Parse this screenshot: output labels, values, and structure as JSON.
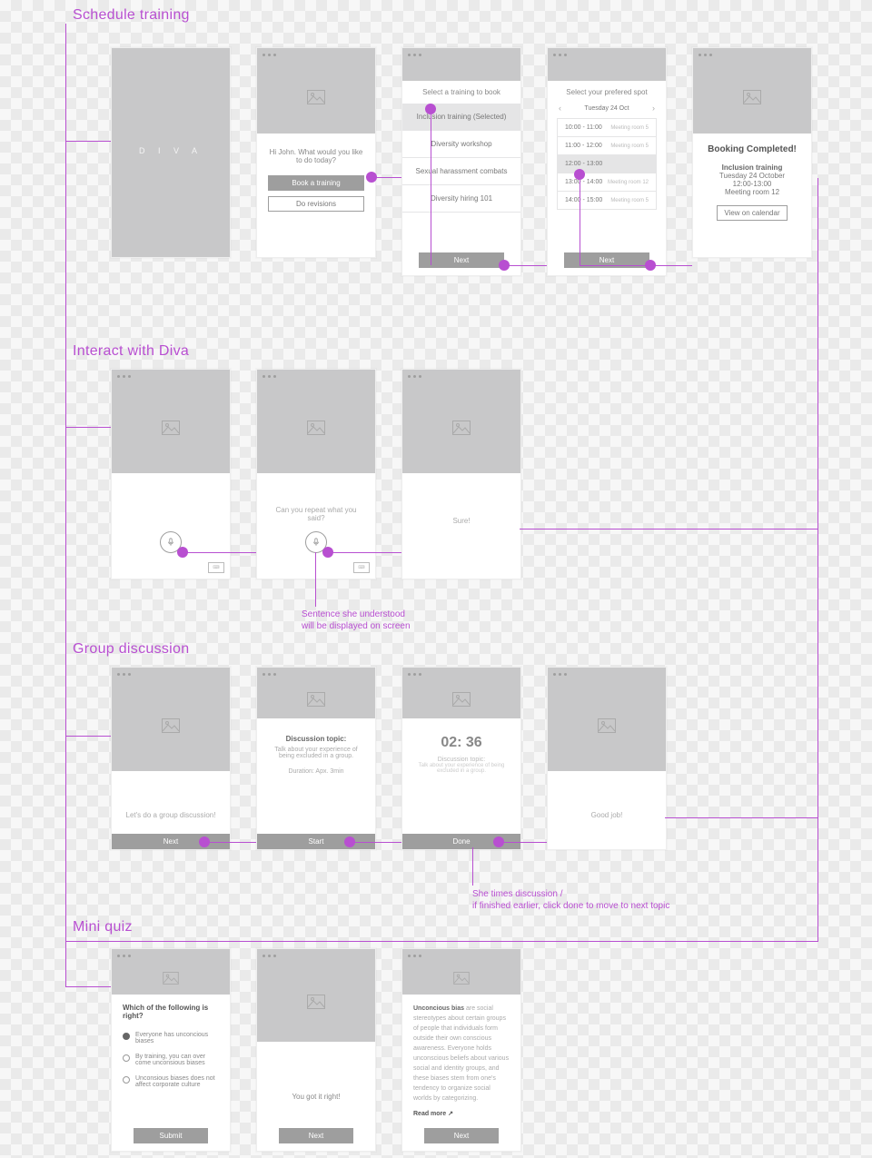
{
  "sections": {
    "schedule": "Schedule training",
    "interact": "Interact with Diva",
    "group": "Group discussion",
    "quiz": "Mini quiz"
  },
  "schedule": {
    "logo": "D  I  V  A",
    "greeting": "Hi John. What would you like to do today?",
    "book_btn": "Book a training",
    "rev_btn": "Do revisions",
    "select_title": "Select a training to book",
    "trainings": [
      "Inclusion training (Selected)",
      "Diversity workshop",
      "Sexual harassment combats",
      "Diversity hiring 101"
    ],
    "next": "Next",
    "spot_title": "Select your prefered spot",
    "date": "Tuesday 24 Oct",
    "slots": [
      {
        "time": "10:00 - 11:00",
        "room": "Meeting room 5"
      },
      {
        "time": "11:00 - 12:00",
        "room": "Meeting room 5"
      },
      {
        "time": "12:00 - 13:00",
        "room": ""
      },
      {
        "time": "13:00 - 14:00",
        "room": "Meeting room 12"
      },
      {
        "time": "14:00 - 15:00",
        "room": "Meeting room 5"
      }
    ],
    "done_title": "Booking Completed!",
    "done_name": "Inclusion training",
    "done_date": "Tuesday 24 October",
    "done_time": "12:00-13:00",
    "done_room": "Meeting room 12",
    "done_btn": "View on calendar"
  },
  "interact": {
    "q": "Can you repeat what you said?",
    "a": "Sure!",
    "note": "Sentence she understood\nwill be displayed on screen"
  },
  "group": {
    "intro": "Let's do a group discussion!",
    "topic_label": "Discussion topic:",
    "topic": "Talk about your experience of being excluded in a group.",
    "duration": "Duration: Apx. 3min",
    "timer": "02: 36",
    "next": "Next",
    "start": "Start",
    "done": "Done",
    "good": "Good job!",
    "note": "She times discussion /\nif finished earlier, click done to move to next topic"
  },
  "quiz": {
    "q": "Which of the following is right?",
    "opts": [
      "Everyone has unconcious biases",
      "By training, you can over come unconsious biases",
      "Unconsious biases does not affect corporate culture"
    ],
    "submit": "Submit",
    "right": "You got it right!",
    "next": "Next",
    "def_title": "Unconcious bias",
    "def_body": "are social stereotypes about certain groups of people that individuals form outside their own conscious awareness. Everyone holds unconscious beliefs about various social and identity groups, and these biases stem from one's tendency to organize social worlds by categorizing.",
    "read_more": "Read more"
  }
}
